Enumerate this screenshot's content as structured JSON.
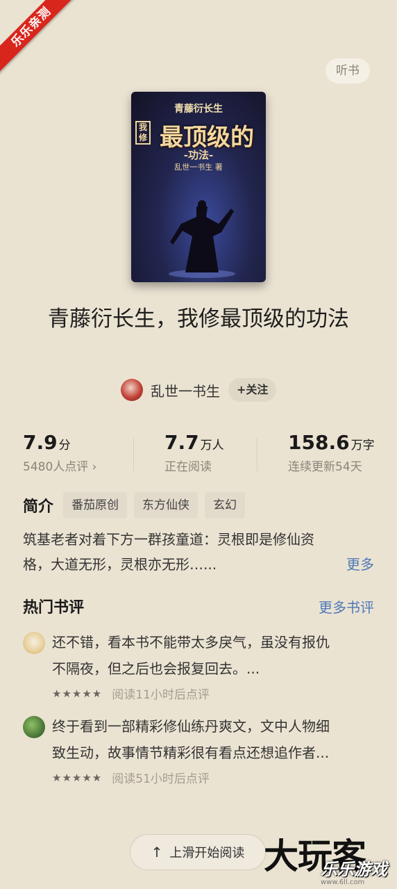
{
  "ribbon": {
    "text": "乐乐亲测"
  },
  "header": {
    "listen_label": "听书"
  },
  "cover": {
    "series": "青藤衍长生",
    "wo_xiu": "我修",
    "main": "最顶级的",
    "sub": "-功法-",
    "author": "乱世一书生 著"
  },
  "book": {
    "title": "青藤衍长生，我修最顶级的功法"
  },
  "author": {
    "name": "乱世一书生",
    "follow_label": "+关注"
  },
  "stats": {
    "score": {
      "value": "7.9",
      "unit": "分",
      "sub": "5480人点评 ›"
    },
    "readers": {
      "value": "7.7",
      "unit": "万人",
      "sub": "正在阅读"
    },
    "words": {
      "value": "158.6",
      "unit": "万字",
      "sub": "连续更新54天"
    }
  },
  "intro": {
    "label": "简介",
    "tags": [
      "番茄原创",
      "东方仙侠",
      "玄幻"
    ],
    "line1": "筑基老者对着下方一群孩童道：灵根即是修仙资",
    "line2": "格，大道无形，灵根亦无形…...",
    "more_label": "更多"
  },
  "reviews": {
    "heading": "热门书评",
    "more_label": "更多书评",
    "items": [
      {
        "line1": "还不错，看本书不能带太多戾气，虽没有报仇",
        "line2": "不隔夜，但之后也会报复回去。...",
        "stars": "★★★★★",
        "meta": "阅读11小时后点评",
        "avatar_color": "#e9d9a8"
      },
      {
        "line1": "终于看到一部精彩修仙练丹爽文，文中人物细",
        "line2": "致生动，故事情节精彩很有看点还想追作者...",
        "stars": "★★★★★",
        "meta": "阅读51小时后点评",
        "avatar_color": "#4d7a3a"
      }
    ]
  },
  "footer": {
    "start_label": "上滑开始阅读",
    "start_icon": "arrow-up-icon"
  },
  "watermark": {
    "main": "大玩客",
    "overlay": "乐乐游戏",
    "url": "www.6ll.com"
  }
}
